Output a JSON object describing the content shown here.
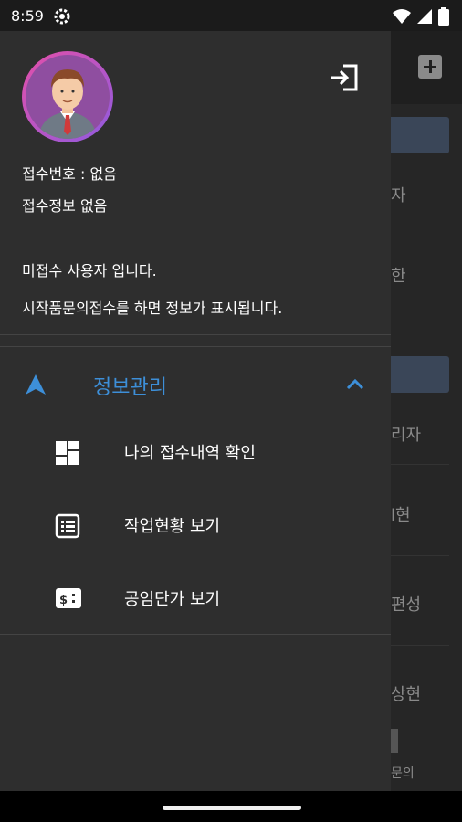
{
  "status_bar": {
    "time": "8:59"
  },
  "background_app": {
    "items": [
      "자",
      "한",
      "리자",
      "l현",
      "편성",
      "상현"
    ],
    "bottom_label": "문의"
  },
  "drawer": {
    "receipt_number": "접수번호 : 없음",
    "receipt_info": "접수정보 없음",
    "user_status": "미접수 사용자 입니다.",
    "hint": "시작품문의접수를 하면 정보가 표시됩니다.",
    "section": {
      "label": "정보관리",
      "color": "#3d8fd8"
    },
    "menu": [
      {
        "label": "나의 접수내역 확인",
        "icon": "dashboard-icon"
      },
      {
        "label": "작업현황 보기",
        "icon": "list-icon"
      },
      {
        "label": "공임단가 보기",
        "icon": "price-icon"
      }
    ]
  }
}
